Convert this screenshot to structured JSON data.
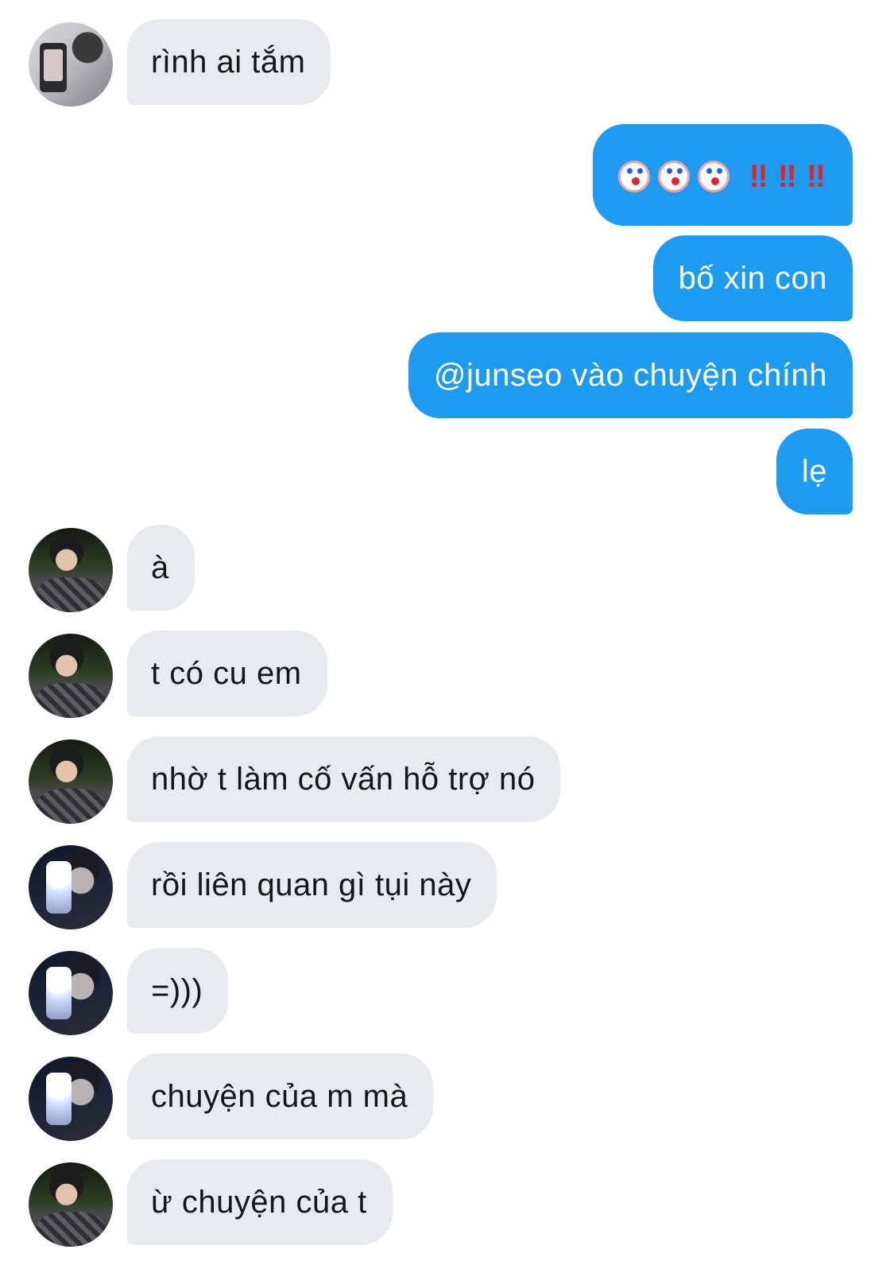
{
  "messages": [
    {
      "side": "in",
      "avatar": "a1",
      "text": "rình ai tắm"
    },
    {
      "side": "out",
      "text": "🤡🤡🤡‼️‼️‼️",
      "emoji": [
        "clown-face-emoji",
        "clown-face-emoji",
        "clown-face-emoji"
      ],
      "marks": [
        "‼",
        "‼",
        "‼"
      ]
    },
    {
      "side": "out",
      "text": "bố xin con"
    },
    {
      "side": "out",
      "text": "@junseo vào chuyện chính"
    },
    {
      "side": "out",
      "text": "lẹ"
    },
    {
      "side": "in",
      "avatar": "a2",
      "text": "à"
    },
    {
      "side": "in",
      "avatar": "a2",
      "text": "t có cu em"
    },
    {
      "side": "in",
      "avatar": "a2",
      "text": "nhờ t làm cố vấn hỗ trợ nó"
    },
    {
      "side": "in",
      "avatar": "a3",
      "text": "rồi liên quan gì tụi này"
    },
    {
      "side": "in",
      "avatar": "a3",
      "text": "=)))"
    },
    {
      "side": "in",
      "avatar": "a3",
      "text": "chuyện của m mà"
    },
    {
      "side": "in",
      "avatar": "a2",
      "text": "ừ chuyện của t"
    }
  ],
  "colors": {
    "incoming_bubble": "#e8ebee",
    "outgoing_bubble": "#1d9bf0",
    "incoming_text": "#14171a",
    "outgoing_text": "#ffffff"
  }
}
